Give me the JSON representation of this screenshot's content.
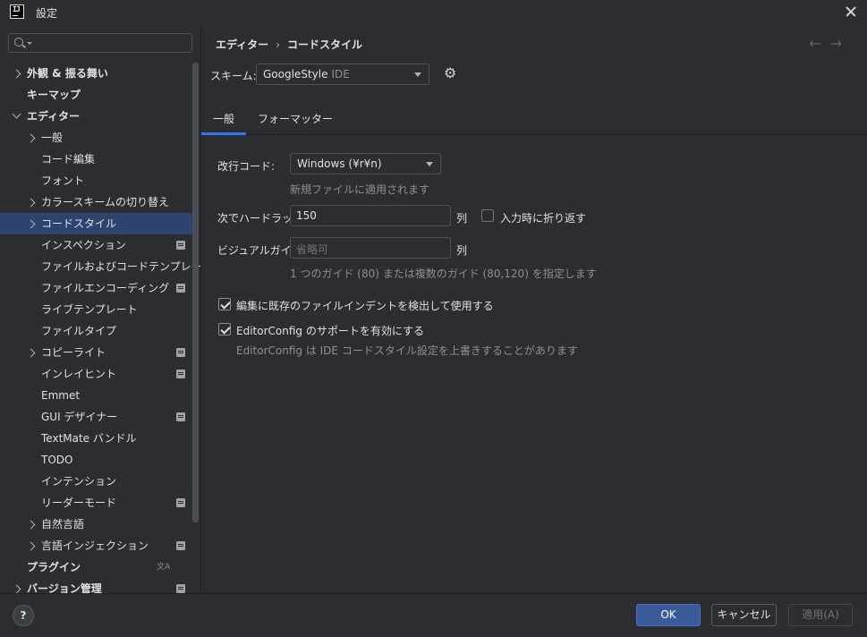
{
  "window": {
    "title": "設定",
    "app_icon_text": "IJ"
  },
  "sidebar": {
    "search_placeholder": "",
    "items": [
      {
        "label": "外観 & 振る舞い",
        "chev": "right",
        "bold": true
      },
      {
        "label": "キーマップ",
        "chev": "",
        "bold": true
      },
      {
        "label": "エディター",
        "chev": "down",
        "bold": true
      },
      {
        "label": "一般",
        "chev": "right"
      },
      {
        "label": "コード編集"
      },
      {
        "label": "フォント"
      },
      {
        "label": "カラースキームの切り替え",
        "chev": "right"
      },
      {
        "label": "コードスタイル",
        "chev": "right",
        "selected": true
      },
      {
        "label": "インスペクション",
        "mod": true
      },
      {
        "label": "ファイルおよびコードテンプレート"
      },
      {
        "label": "ファイルエンコーディング",
        "mod": true
      },
      {
        "label": "ライブテンプレート"
      },
      {
        "label": "ファイルタイプ"
      },
      {
        "label": "コピーライト",
        "chev": "right",
        "mod": true
      },
      {
        "label": "インレイヒント",
        "mod": true
      },
      {
        "label": "Emmet"
      },
      {
        "label": "GUI デザイナー",
        "mod": true
      },
      {
        "label": "TextMate バンドル"
      },
      {
        "label": "TODO"
      },
      {
        "label": "インテンション"
      },
      {
        "label": "リーダーモード",
        "mod": true
      },
      {
        "label": "自然言語",
        "chev": "right"
      },
      {
        "label": "言語インジェクション",
        "chev": "right",
        "mod": true
      },
      {
        "label": "プラグイン",
        "bold": true,
        "translate": true
      },
      {
        "label": "バージョン管理",
        "chev": "right",
        "bold": true,
        "mod": true
      }
    ]
  },
  "main": {
    "breadcrumb": [
      "エディター",
      "コードスタイル"
    ],
    "breadcrumb_sep": "›",
    "nav_back": "←",
    "nav_forward": "→",
    "scheme_label": "スキーム:",
    "scheme_value": "GoogleStyle",
    "scheme_sub": "IDE",
    "tabs": [
      "一般",
      "フォーマッター"
    ],
    "line_sep_label": "改行コード:",
    "line_sep_value": "Windows (¥r¥n)",
    "line_sep_hint": "新規ファイルに適用されます",
    "hard_wrap_label": "次でハードラップ:",
    "hard_wrap_value": "150",
    "hard_wrap_unit": "列",
    "wrap_on_typing_label": "入力時に折り返す",
    "visual_guides_label": "ビジュアルガイド:",
    "visual_guides_placeholder": "省略可",
    "visual_guides_unit": "列",
    "visual_guides_hint": "1 つのガイド (80) または複数のガイド (80,120) を指定します",
    "detect_indent_label": "編集に既存のファイルインデントを検出して使用する",
    "editorconfig_label": "EditorConfig のサポートを有効にする",
    "editorconfig_hint": "EditorConfig は IDE コードスタイル設定を上書きすることがあります"
  },
  "footer": {
    "help": "?",
    "ok": "OK",
    "cancel": "キャンセル",
    "apply": "適用(A)"
  }
}
